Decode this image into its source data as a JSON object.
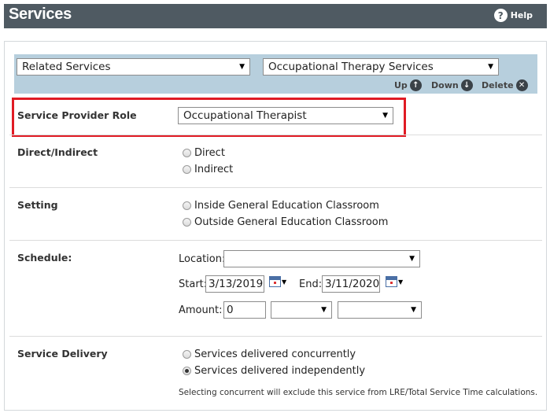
{
  "header": {
    "title": "Services",
    "help_label": "Help",
    "help_icon": "question-circle-icon"
  },
  "toolbar": {
    "category_select": "Related Services",
    "service_select": "Occupational Therapy Services",
    "up_label": "Up",
    "down_label": "Down",
    "delete_label": "Delete"
  },
  "provider": {
    "label": "Service Provider Role",
    "value": "Occupational Therapist"
  },
  "direct_indirect": {
    "label": "Direct/Indirect",
    "options": [
      {
        "label": "Direct",
        "checked": false
      },
      {
        "label": "Indirect",
        "checked": false
      }
    ]
  },
  "setting": {
    "label": "Setting",
    "options": [
      {
        "label": "Inside General Education Classroom",
        "checked": false
      },
      {
        "label": "Outside General Education Classroom",
        "checked": false
      }
    ]
  },
  "schedule": {
    "label": "Schedule:",
    "location_label": "Location:",
    "location_value": "",
    "start_label": "Start:",
    "start_value": "3/13/2019",
    "end_label": "End:",
    "end_value": "3/11/2020",
    "amount_label": "Amount:",
    "amount_value": "0",
    "amount_unit": "",
    "amount_frequency": ""
  },
  "delivery": {
    "label": "Service Delivery",
    "options": [
      {
        "label": "Services delivered concurrently",
        "checked": false
      },
      {
        "label": "Services delivered independently",
        "checked": true
      }
    ],
    "note": "Selecting concurrent will exclude this service from LRE/Total Service Time calculations."
  },
  "colors": {
    "header_bg": "#4f5a62",
    "toolbar_bg": "#b7cfdd",
    "highlight_border": "#e01b24"
  }
}
